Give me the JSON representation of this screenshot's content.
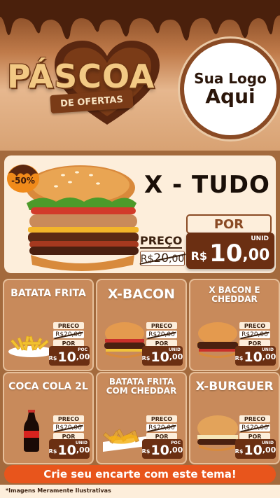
{
  "header": {
    "title_word": "PÁSCOA",
    "ribbon": "DE OFERTAS",
    "logo_line1": "Sua Logo",
    "logo_line2": "Aqui"
  },
  "hero": {
    "discount": "-50%",
    "title": "X - TUDO",
    "preco_label": "PREÇO",
    "por_label": "POR",
    "old_price_cur": "R$",
    "old_price_int": "20",
    "old_price_dec": ",00",
    "new_price_cur": "R$",
    "new_price_int": "10",
    "new_price_dec": ",00",
    "unit": "UNID"
  },
  "cards": [
    {
      "title": "BATATA FRITA",
      "preco": "PRECO",
      "old": "R$20,00",
      "por": "POR",
      "cur": "R$",
      "int": "10",
      "dec": ",00",
      "unit": "POC"
    },
    {
      "title": "X-BACON",
      "preco": "PRECO",
      "old": "R$20,00",
      "por": "POR",
      "cur": "R$",
      "int": "10",
      "dec": ",00",
      "unit": "UNID"
    },
    {
      "title": "X BACON E CHEDDAR",
      "preco": "PRECO",
      "old": "R$20,00",
      "por": "POR",
      "cur": "R$",
      "int": "10",
      "dec": ",00",
      "unit": "UNID"
    },
    {
      "title": "COCA COLA 2L",
      "preco": "PRECO",
      "old": "R$20,00",
      "por": "POR",
      "cur": "R$",
      "int": "10",
      "dec": ",00",
      "unit": "UNID"
    },
    {
      "title": "BATATA FRITA COM CHEDDAR",
      "preco": "PRECO",
      "old": "R$20,00",
      "por": "POR",
      "cur": "R$",
      "int": "10",
      "dec": ",00",
      "unit": "POC"
    },
    {
      "title": "X-BURGUER",
      "preco": "PRECO",
      "old": "R$20,00",
      "por": "POR",
      "cur": "R$",
      "int": "10",
      "dec": ",00",
      "unit": "UNID"
    }
  ],
  "cta": "Crie seu encarte com este tema!",
  "footnote": "*Imagens Meramente Ilustrativas",
  "colors": {
    "accent": "#e8551c",
    "chocolate": "#6b2f12",
    "card": "#c88a5b",
    "cream": "#fdeedb"
  }
}
